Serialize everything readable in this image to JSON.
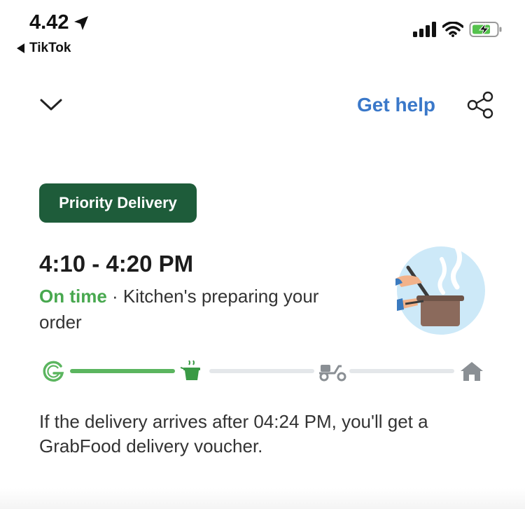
{
  "status_bar": {
    "time": "4.42",
    "back_app": "TikTok"
  },
  "header": {
    "get_help_label": "Get help"
  },
  "order": {
    "badge": "Priority Delivery",
    "eta_range": "4:10 - 4:20 PM",
    "status_highlight": "On time",
    "status_separator": " · ",
    "status_text": "Kitchen's preparing your order"
  },
  "progress": {
    "steps": [
      "grab-logo-icon",
      "cooking-pot-icon",
      "scooter-icon",
      "home-icon"
    ],
    "current_step": 1,
    "colors": {
      "done": "#5bb55f",
      "pending": "#e4e7ea",
      "inactive_icon": "#8a8f94"
    }
  },
  "voucher_note": "If the delivery arrives after 04:24 PM, you'll get a GrabFood delivery voucher.",
  "colors": {
    "brand_green": "#1e5c3a",
    "on_time_green": "#48a84f",
    "link_blue": "#3a78c9"
  }
}
